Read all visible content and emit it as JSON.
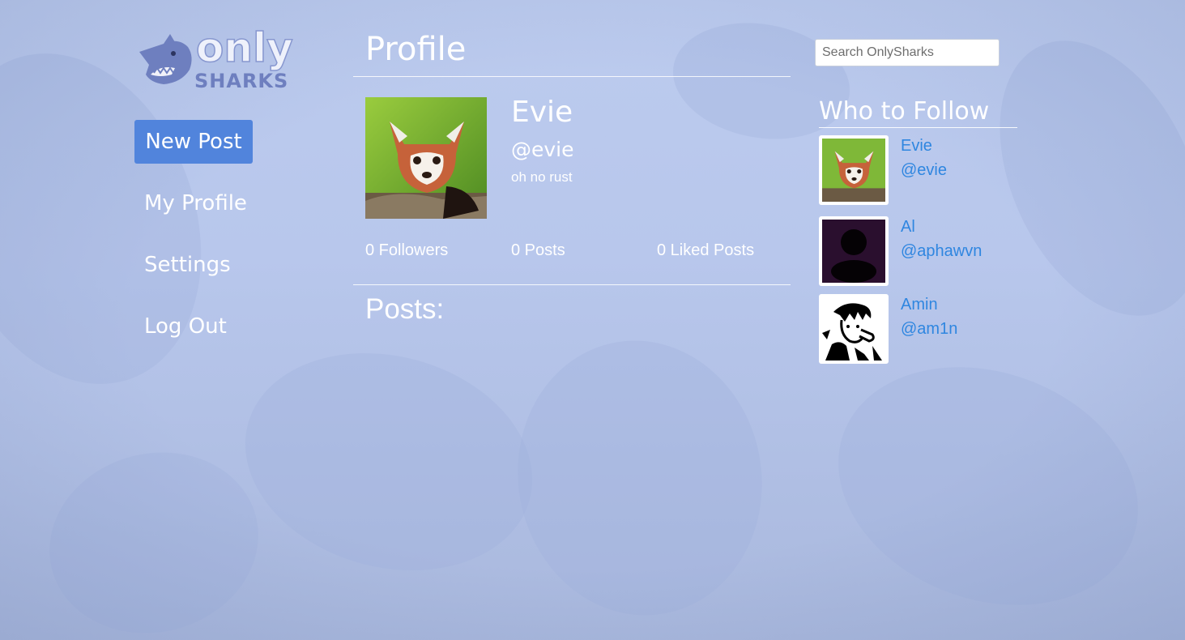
{
  "app": {
    "logo_text_top": "only",
    "logo_text_bottom": "SHARKS"
  },
  "nav": {
    "new_post_label": "New Post",
    "items": [
      {
        "label": "My Profile"
      },
      {
        "label": "Settings"
      },
      {
        "label": "Log Out"
      }
    ]
  },
  "profile": {
    "page_title": "Profile",
    "name": "Evie",
    "handle": "@evie",
    "bio": "oh no rust",
    "avatar_icon": "red-panda-photo",
    "stats": {
      "followers": "0 Followers",
      "posts": "0 Posts",
      "liked": "0 Liked Posts"
    },
    "posts_heading": "Posts:"
  },
  "search": {
    "placeholder": "Search OnlySharks"
  },
  "who_to_follow": {
    "heading": "Who to Follow",
    "users": [
      {
        "name": "Evie",
        "handle": "@evie",
        "avatar_icon": "red-panda-photo"
      },
      {
        "name": "Al",
        "handle": "@aphawvn",
        "avatar_icon": "default-user-silhouette"
      },
      {
        "name": "Amin",
        "handle": "@am1n",
        "avatar_icon": "sketch-portrait"
      }
    ]
  },
  "colors": {
    "background": "#b8c7ec",
    "accent_button": "#5184dc",
    "link": "#2f86e0",
    "text": "#ffffff"
  }
}
